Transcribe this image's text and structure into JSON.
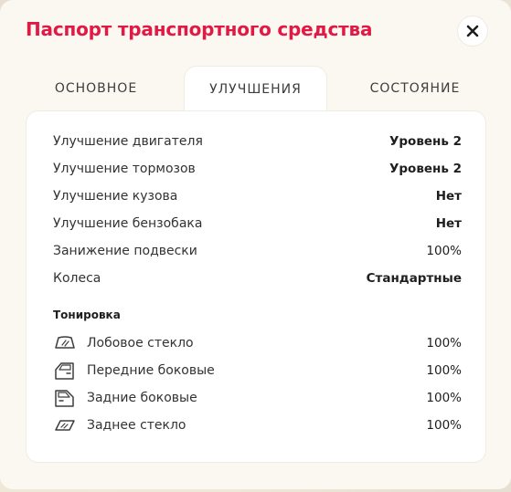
{
  "modal": {
    "title": "Паспорт транспортного средства",
    "close_icon": "close-icon"
  },
  "tabs": [
    {
      "label": "ОСНОВНОЕ",
      "active": false
    },
    {
      "label": "УЛУЧШЕНИЯ",
      "active": true
    },
    {
      "label": "СОСТОЯНИЕ",
      "active": false
    }
  ],
  "upgrades": [
    {
      "label": "Улучшение двигателя",
      "value": "Уровень 2"
    },
    {
      "label": "Улучшение тормозов",
      "value": "Уровень 2"
    },
    {
      "label": "Улучшение кузова",
      "value": "Нет"
    },
    {
      "label": "Улучшение бензобака",
      "value": "Нет"
    },
    {
      "label": "Занижение подвески",
      "value": "100%"
    },
    {
      "label": "Колеса",
      "value": "Стандартные"
    }
  ],
  "tinting": {
    "title": "Тонировка",
    "items": [
      {
        "label": "Лобовое стекло",
        "value": "100%",
        "icon": "windshield-icon"
      },
      {
        "label": "Передние боковые",
        "value": "100%",
        "icon": "front-side-window-icon"
      },
      {
        "label": "Задние боковые",
        "value": "100%",
        "icon": "rear-side-window-icon"
      },
      {
        "label": "Заднее стекло",
        "value": "100%",
        "icon": "rear-window-icon"
      }
    ]
  },
  "colors": {
    "accent": "#e01a45",
    "panel": "#ffffff",
    "modal_bg": "#fbf8f2"
  }
}
